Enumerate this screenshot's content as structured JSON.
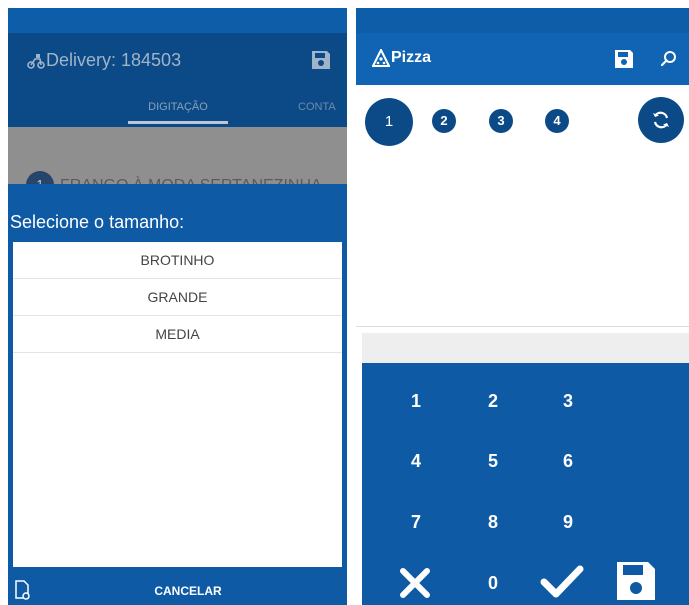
{
  "left_screen": {
    "app_bar": {
      "title": "Delivery: 184503",
      "icon": "motorcycle-icon",
      "action_icon": "save-icon"
    },
    "tabs": [
      {
        "label": "DIGITAÇÃO",
        "selected": true
      },
      {
        "label": "CONTA",
        "selected": false
      }
    ],
    "background_item": {
      "number": "1",
      "name": "FRANGO À MODA SERTANEZINHA"
    },
    "dialog": {
      "title": "Selecione o tamanho:",
      "options": [
        "BROTINHO",
        "GRANDE",
        "MEDIA"
      ],
      "cancel_label": "CANCELAR",
      "footer_icon": "document-settings-icon"
    }
  },
  "right_screen": {
    "app_bar": {
      "title": "Pizza",
      "icon": "pizza-slice-icon",
      "actions": [
        "save-icon",
        "search-icon"
      ]
    },
    "steps": [
      {
        "label": "1",
        "active": true
      },
      {
        "label": "2",
        "active": false
      },
      {
        "label": "3",
        "active": false
      },
      {
        "label": "4",
        "active": false
      }
    ],
    "refresh_icon": "refresh-icon",
    "display_value": "",
    "keypad": {
      "digits": [
        "1",
        "2",
        "3",
        "4",
        "5",
        "6",
        "7",
        "8",
        "9",
        "0"
      ],
      "clear_icon": "close-icon",
      "confirm_icon": "check-icon",
      "save_icon": "save-icon"
    }
  },
  "colors": {
    "primary": "#1064b3",
    "dark_primary": "#0b4a86",
    "dialog_blue": "#0e5aa5",
    "dim_overlay": "#8f8f8f"
  }
}
